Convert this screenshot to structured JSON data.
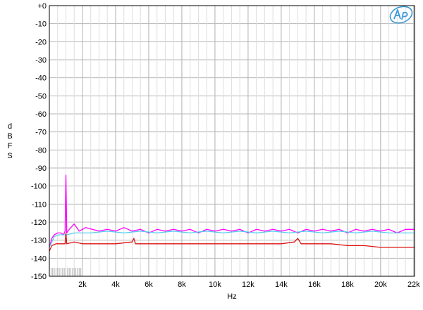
{
  "chart_data": {
    "type": "line",
    "xlabel": "Hz",
    "ylabel": "dBFS",
    "ylabel_letters": [
      "d",
      "B",
      "F",
      "S"
    ],
    "xscale": "linear",
    "xlim": [
      0,
      22050
    ],
    "ylim": [
      -150,
      0
    ],
    "grid": true,
    "x_minor_grid_every": 500,
    "x_ticks": [
      {
        "v": 2000,
        "label": "2k"
      },
      {
        "v": 4000,
        "label": "4k"
      },
      {
        "v": 6000,
        "label": "6k"
      },
      {
        "v": 8000,
        "label": "8k"
      },
      {
        "v": 10000,
        "label": "10k"
      },
      {
        "v": 12000,
        "label": "12k"
      },
      {
        "v": 14000,
        "label": "14k"
      },
      {
        "v": 16000,
        "label": "16k"
      },
      {
        "v": 18000,
        "label": "18k"
      },
      {
        "v": 20000,
        "label": "20k"
      },
      {
        "v": 22000,
        "label": "22k"
      }
    ],
    "y_ticks": [
      {
        "v": 0,
        "label": "+0"
      },
      {
        "v": -10,
        "label": "-10"
      },
      {
        "v": -20,
        "label": "-20"
      },
      {
        "v": -30,
        "label": "-30"
      },
      {
        "v": -40,
        "label": "-40"
      },
      {
        "v": -50,
        "label": "-50"
      },
      {
        "v": -60,
        "label": "-60"
      },
      {
        "v": -70,
        "label": "-70"
      },
      {
        "v": -80,
        "label": "-80"
      },
      {
        "v": -90,
        "label": "-90"
      },
      {
        "v": -100,
        "label": "-100"
      },
      {
        "v": -110,
        "label": "-110"
      },
      {
        "v": -120,
        "label": "-120"
      },
      {
        "v": -130,
        "label": "-130"
      },
      {
        "v": -140,
        "label": "-140"
      },
      {
        "v": -150,
        "label": "-150"
      }
    ],
    "series": [
      {
        "color": "#ff00ff",
        "points": [
          [
            0,
            -134
          ],
          [
            150,
            -129
          ],
          [
            300,
            -127
          ],
          [
            500,
            -126
          ],
          [
            700,
            -126
          ],
          [
            850,
            -127
          ],
          [
            950,
            -125
          ],
          [
            1000,
            -94
          ],
          [
            1050,
            -126
          ],
          [
            1200,
            -124
          ],
          [
            1500,
            -121
          ],
          [
            1800,
            -125
          ],
          [
            2200,
            -123
          ],
          [
            2600,
            -124
          ],
          [
            3000,
            -125
          ],
          [
            3500,
            -124
          ],
          [
            4000,
            -125
          ],
          [
            4500,
            -123
          ],
          [
            5000,
            -125
          ],
          [
            5500,
            -124
          ],
          [
            6000,
            -126
          ],
          [
            6500,
            -124
          ],
          [
            7000,
            -125
          ],
          [
            7500,
            -124
          ],
          [
            8000,
            -125
          ],
          [
            8500,
            -124
          ],
          [
            9000,
            -126
          ],
          [
            9500,
            -124
          ],
          [
            10000,
            -125
          ],
          [
            10500,
            -124
          ],
          [
            11000,
            -125
          ],
          [
            11500,
            -124
          ],
          [
            12000,
            -126
          ],
          [
            12500,
            -124
          ],
          [
            13000,
            -125
          ],
          [
            13500,
            -124
          ],
          [
            14000,
            -125
          ],
          [
            14500,
            -124
          ],
          [
            15000,
            -126
          ],
          [
            15500,
            -124
          ],
          [
            16000,
            -125
          ],
          [
            16500,
            -124
          ],
          [
            17000,
            -125
          ],
          [
            17500,
            -124
          ],
          [
            18000,
            -126
          ],
          [
            18500,
            -124
          ],
          [
            19000,
            -125
          ],
          [
            19500,
            -124
          ],
          [
            20000,
            -125
          ],
          [
            20500,
            -124
          ],
          [
            21000,
            -126
          ],
          [
            21500,
            -124
          ],
          [
            22050,
            -124
          ]
        ]
      },
      {
        "color": "#55ccee",
        "points": [
          [
            0,
            -134
          ],
          [
            300,
            -128
          ],
          [
            600,
            -127
          ],
          [
            950,
            -127
          ],
          [
            1000,
            -128
          ],
          [
            1050,
            -127
          ],
          [
            1500,
            -126
          ],
          [
            2500,
            -126
          ],
          [
            3500,
            -125
          ],
          [
            4500,
            -126
          ],
          [
            5500,
            -125
          ],
          [
            6500,
            -126
          ],
          [
            7500,
            -125
          ],
          [
            8500,
            -126
          ],
          [
            9500,
            -125
          ],
          [
            10500,
            -126
          ],
          [
            11500,
            -125
          ],
          [
            12500,
            -126
          ],
          [
            13500,
            -125
          ],
          [
            14500,
            -126
          ],
          [
            15500,
            -125
          ],
          [
            16500,
            -126
          ],
          [
            17500,
            -125
          ],
          [
            18500,
            -126
          ],
          [
            19500,
            -125
          ],
          [
            20500,
            -126
          ],
          [
            21500,
            -126
          ],
          [
            22050,
            -126
          ]
        ]
      },
      {
        "color": "#dd1111",
        "points": [
          [
            0,
            -136
          ],
          [
            150,
            -133
          ],
          [
            400,
            -132
          ],
          [
            700,
            -132
          ],
          [
            950,
            -132
          ],
          [
            1000,
            -126
          ],
          [
            1050,
            -132
          ],
          [
            1500,
            -131
          ],
          [
            2000,
            -132
          ],
          [
            3000,
            -132
          ],
          [
            4000,
            -132
          ],
          [
            5000,
            -131
          ],
          [
            5100,
            -129
          ],
          [
            5200,
            -132
          ],
          [
            6000,
            -132
          ],
          [
            7000,
            -132
          ],
          [
            8000,
            -132
          ],
          [
            9000,
            -132
          ],
          [
            10000,
            -132
          ],
          [
            11000,
            -132
          ],
          [
            12000,
            -132
          ],
          [
            13000,
            -132
          ],
          [
            14000,
            -132
          ],
          [
            14800,
            -131
          ],
          [
            15000,
            -129
          ],
          [
            15200,
            -132
          ],
          [
            16000,
            -132
          ],
          [
            17000,
            -132
          ],
          [
            18000,
            -133
          ],
          [
            19000,
            -133
          ],
          [
            20000,
            -134
          ],
          [
            21000,
            -134
          ],
          [
            22050,
            -134
          ]
        ]
      }
    ]
  }
}
